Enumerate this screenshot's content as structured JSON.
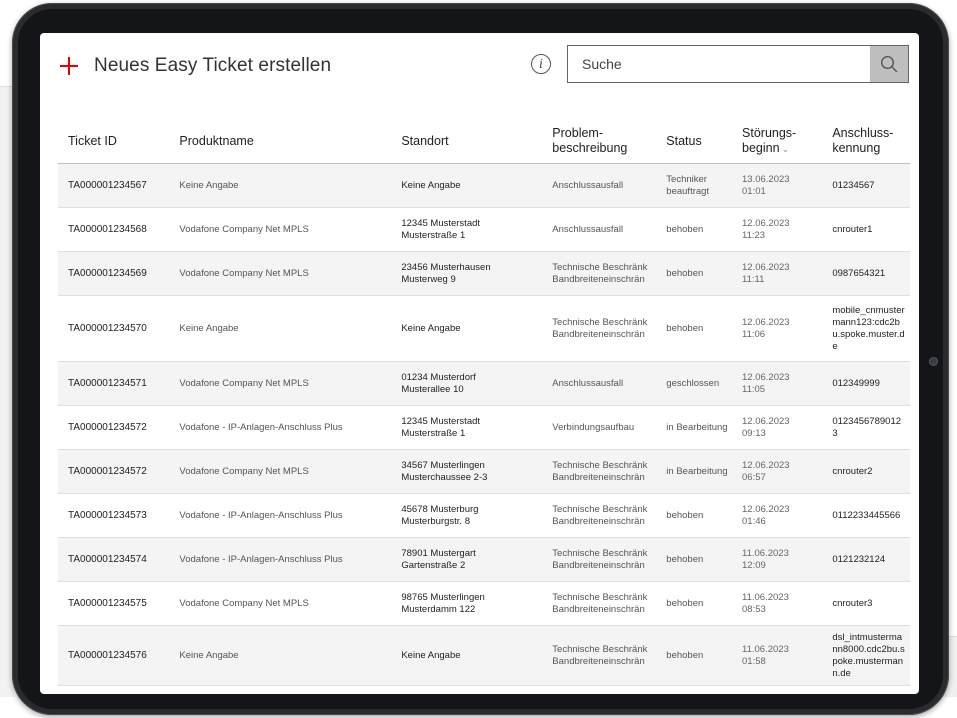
{
  "header": {
    "new_ticket_label": "Neues Easy Ticket erstellen",
    "info_symbol": "i",
    "search_placeholder": "Suche"
  },
  "table": {
    "columns": [
      {
        "key": "id",
        "line1": "Ticket ID",
        "line2": ""
      },
      {
        "key": "product",
        "line1": "Produktname",
        "line2": ""
      },
      {
        "key": "location",
        "line1": "Standort",
        "line2": ""
      },
      {
        "key": "problem",
        "line1": "Problem-",
        "line2": "beschreibung"
      },
      {
        "key": "status",
        "line1": "Status",
        "line2": ""
      },
      {
        "key": "start",
        "line1": "Störungs-",
        "line2": "beginn"
      },
      {
        "key": "connection",
        "line1": "Anschluss-",
        "line2": "kennung"
      }
    ],
    "rows": [
      {
        "id": "TA000001234567",
        "product": "Keine Angabe",
        "loc1": "Keine Angabe",
        "loc2": "",
        "prob1": "Anschlussausfall",
        "prob2": "",
        "status": "Techniker beauftragt",
        "date": "13.06.2023",
        "time": "01:01",
        "connection": "01234567"
      },
      {
        "id": "TA000001234568",
        "product": "Vodafone Company Net MPLS",
        "loc1": "12345 Musterstadt",
        "loc2": "Musterstraße 1",
        "prob1": "Anschlussausfall",
        "prob2": "",
        "status": "behoben",
        "date": "12.06.2023",
        "time": "11:23",
        "connection": "cnrouter1"
      },
      {
        "id": "TA000001234569",
        "product": "Vodafone Company Net MPLS",
        "loc1": "23456 Musterhausen",
        "loc2": "Musterweg 9",
        "prob1": "Technische Beschränk",
        "prob2": "Bandbreiteneinschrän",
        "status": "behoben",
        "date": "12.06.2023",
        "time": "11:11",
        "connection": "0987654321"
      },
      {
        "id": "TA000001234570",
        "product": "Keine Angabe",
        "loc1": "Keine Angabe",
        "loc2": "",
        "prob1": "Technische Beschränk",
        "prob2": "Bandbreiteneinschrän",
        "status": "behoben",
        "date": "12.06.2023",
        "time": "11:06",
        "connection": "mobile_cnmustermann123:cdc2bu.spoke.muster.de"
      },
      {
        "id": "TA000001234571",
        "product": "Vodafone Company Net MPLS",
        "loc1": "01234 Musterdorf",
        "loc2": "Musterallee 10",
        "prob1": "Anschlussausfall",
        "prob2": "",
        "status": "geschlossen",
        "date": "12.06.2023",
        "time": "11:05",
        "connection": "012349999"
      },
      {
        "id": "TA000001234572",
        "product": "Vodafone - IP-Anlagen-Anschluss Plus",
        "loc1": "12345 Musterstadt",
        "loc2": "Musterstraße 1",
        "prob1": "Verbindungsaufbau",
        "prob2": "",
        "status": "in Bearbeitung",
        "date": "12.06.2023",
        "time": "09:13",
        "connection": "01234567890123"
      },
      {
        "id": "TA000001234572",
        "product": "Vodafone Company Net MPLS",
        "loc1": "34567 Musterlingen",
        "loc2": "Musterchaussee 2-3",
        "prob1": "Technische Beschränk",
        "prob2": "Bandbreiteneinschrän",
        "status": "in Bearbeitung",
        "date": "12.06.2023",
        "time": "06:57",
        "connection": "cnrouter2"
      },
      {
        "id": "TA000001234573",
        "product": "Vodafone - IP-Anlagen-Anschluss Plus",
        "loc1": "45678 Musterburg",
        "loc2": "Musterburgstr. 8",
        "prob1": "Technische Beschränk",
        "prob2": "Bandbreiteneinschrän",
        "status": "behoben",
        "date": "12.06.2023",
        "time": "01:46",
        "connection": "0112233445566"
      },
      {
        "id": "TA000001234574",
        "product": "Vodafone - IP-Anlagen-Anschluss Plus",
        "loc1": "78901 Mustergart",
        "loc2": "Gartenstraße 2",
        "prob1": "Technische Beschränk",
        "prob2": "Bandbreiteneinschrän",
        "status": "behoben",
        "date": "11.06.2023",
        "time": "12:09",
        "connection": "0121232124"
      },
      {
        "id": "TA000001234575",
        "product": "Vodafone Company Net MPLS",
        "loc1": "98765 Musterlingen",
        "loc2": "Musterdamm 122",
        "prob1": "Technische Beschränk",
        "prob2": "Bandbreiteneinschrän",
        "status": "behoben",
        "date": "11.06.2023",
        "time": "08:53",
        "connection": "cnrouter3"
      },
      {
        "id": "TA000001234576",
        "product": "Keine Angabe",
        "loc1": "Keine Angabe",
        "loc2": "",
        "prob1": "Technische Beschränk",
        "prob2": "Bandbreiteneinschrän",
        "status": "behoben",
        "date": "11.06.2023",
        "time": "01:58",
        "connection": "dsl_intmustermann8000.cdc2bu.spoke.mustermann.de"
      }
    ]
  },
  "icons": {
    "new_ticket": "plus-icon",
    "info": "info-icon",
    "search": "search-icon",
    "sort": "chevron-down-icon"
  },
  "colors": {
    "accent": "#e60000",
    "search_button": "#bebebe",
    "row_stripe": "#f4f4f4"
  }
}
